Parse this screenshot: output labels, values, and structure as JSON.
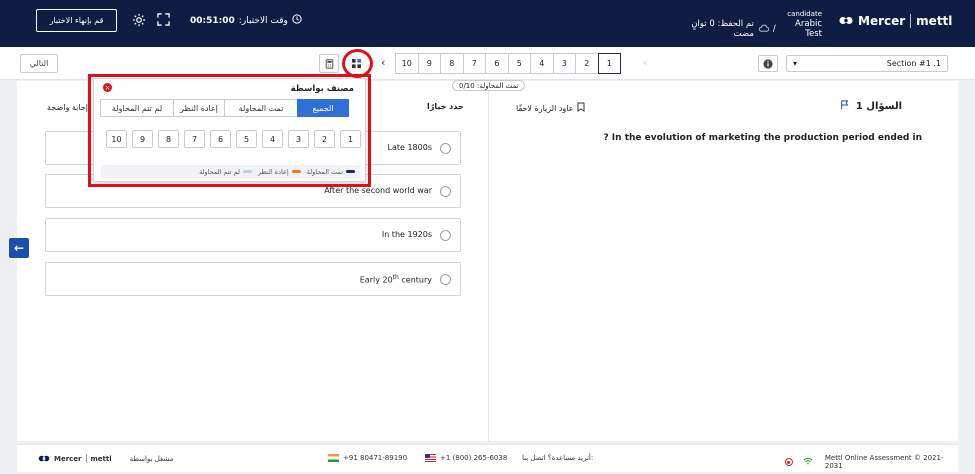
{
  "header": {
    "finish_label": "قم بإنهاء الاختبار",
    "timer_label": "وقت الاختبار:",
    "timer_value": "00:51:00",
    "candidate": "candidate",
    "test_name": "Arabic Test",
    "save_status": "تم الحفظ: 0 ثوانٍ مضت",
    "brand_mercer": "Mercer",
    "brand_mettl": "mettl"
  },
  "nav": {
    "next_label": "التالي",
    "question_numbers": [
      "10",
      "9",
      "8",
      "7",
      "6",
      "5",
      "4",
      "3",
      "2",
      "1"
    ],
    "active_question": "1",
    "attempted_tag": "تمت المحاولة: 0/10",
    "section_label": "Section #1 .1"
  },
  "question": {
    "title": "السؤال 1",
    "text": "? In the evolution of marketing the production period ended in",
    "bookmark_label": "عاود الزيارة لاحقًا",
    "choose_label": "حدد خيارًا",
    "clear_label": "إجابة واضحة",
    "options": [
      "Late 1800s",
      "After the second world war",
      "In the 1920s",
      "Early 20th century"
    ]
  },
  "filter_popup": {
    "title": "مصنف بواسطة",
    "tabs": [
      "الجميع",
      "تمت المحاولة",
      "إعادة النظر",
      "لم تتم المحاولة"
    ],
    "selected_tab": "الجميع",
    "numbers": [
      "1",
      "2",
      "3",
      "4",
      "5",
      "6",
      "7",
      "8",
      "9",
      "10"
    ],
    "legend": [
      {
        "label": "تمت المحاولة",
        "color": "#1d2b56"
      },
      {
        "label": "إعادة النظر",
        "color": "#f07b1e"
      },
      {
        "label": "لم تتم المحاولة",
        "color": "#c9ccd3"
      }
    ]
  },
  "footer": {
    "copyright": "Mettl Online Assessment © 2021-2031",
    "help_label": "أتريد مساعدة؟ اتصل بنا:",
    "us_phone": "+1 (800) 265-6038",
    "in_phone": "+91 80471-89190",
    "powered_label": "مشغل بواسطة",
    "brand_mercer": "Mercer",
    "brand_mettl": "mettl"
  },
  "colors": {
    "header_bg": "#0f1d45",
    "accent": "#2f6fd7",
    "highlight_red": "#e0101b"
  }
}
